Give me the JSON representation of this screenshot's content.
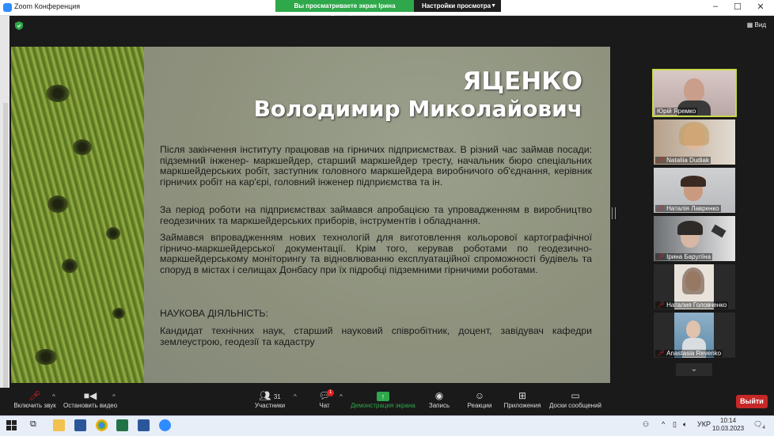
{
  "window": {
    "title": "Zoom Конференция",
    "share_banner": "Вы просматриваете экран Ірина Барулїна",
    "view_settings": "Настройки просмотра",
    "view_button": "Вид"
  },
  "slide": {
    "name_line1": "ЯЦЕНКО",
    "name_line2": "Володимир Миколайович",
    "paragraphs": [
      "Після закінчення інституту працював на гірничих підприємствах. В різний час займав посади: підземний інженер- маркшейдер, старший маркшейдер тресту, начальник бюро спеціальних маркшейдерських робіт, заступник головного маркшейдера виробничого об'єднання, керівник гірничих робіт на кар'єрі, головний інженер підприємства та ін.",
      "За період роботи на підприємствах займався апробацією та упровадженням в виробництво геодезичних та маркшейдерських приборів, інструментів і обладнання.",
      "Займався впровадженням нових технологій для виготовлення кольорової картографічної гірничо-маркшейдерської документації. Крім того, керував роботами по геодезично-маркшейдерському моніторингу та відновлюванню експлуатаційної спроможності будівель та споруд в містах і селищах Донбасу при їх підробці підземними гірничими роботами.",
      "НАУКОВА ДІЯЛЬНІСТЬ:",
      "Кандидат технічних наук, старший науковий співробітник, доцент, завідувач кафедри землеустрою, геодезії та кадастру"
    ]
  },
  "participants": [
    {
      "name": "Юрій Яремко",
      "muted": false,
      "active": true
    },
    {
      "name": "Nataliia Dudiak",
      "muted": true,
      "active": false
    },
    {
      "name": "Наталія Лавренко",
      "muted": true,
      "active": false
    },
    {
      "name": "Ірина Барулїна",
      "muted": true,
      "active": false
    },
    {
      "name": "Наталия Головченко",
      "muted": true,
      "active": false
    },
    {
      "name": "Anastasia Revenko",
      "muted": true,
      "active": false
    }
  ],
  "toolbar": {
    "audio": "Включить звук",
    "video": "Остановить видео",
    "participants": "Участники",
    "participants_count": "31",
    "chat": "Чат",
    "chat_badge": "1",
    "share": "Демонстрация экрана",
    "record": "Запись",
    "reactions": "Реакции",
    "apps": "Приложения",
    "whiteboards": "Доски сообщений",
    "leave": "Выйти"
  },
  "taskbar": {
    "language": "УКР",
    "time": "10:14",
    "date": "10.03.2023",
    "notifications": "4"
  },
  "colors": {
    "share_banner": "#2ea84a",
    "leave": "#c62828",
    "active_speaker": "#c8d94a"
  }
}
